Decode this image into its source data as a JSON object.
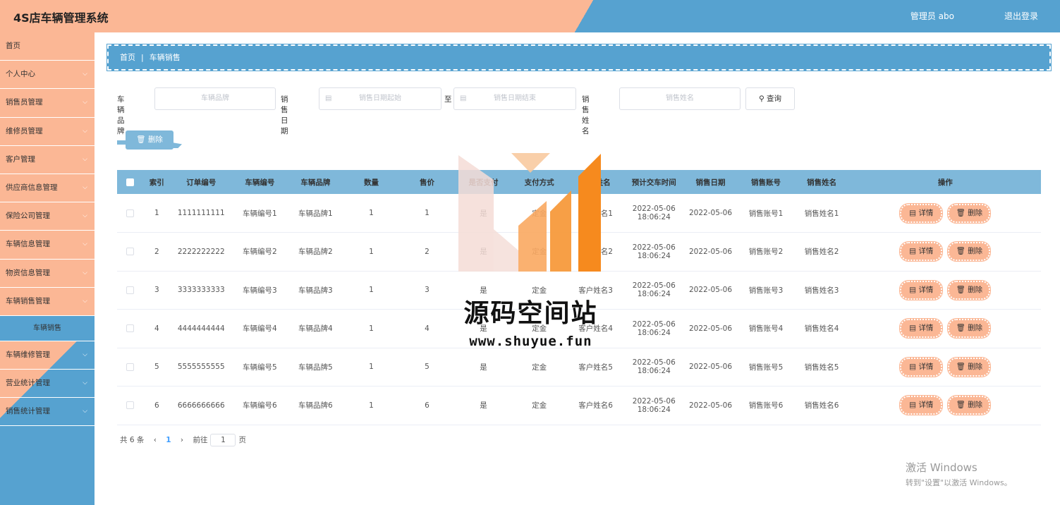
{
  "app": {
    "title": "4S店车辆管理系统",
    "user": "管理员 abo",
    "logout": "退出登录"
  },
  "sidebar": {
    "items": [
      {
        "label": "首页",
        "chevron": false
      },
      {
        "label": "个人中心",
        "chevron": true
      },
      {
        "label": "销售员管理",
        "chevron": true
      },
      {
        "label": "维修员管理",
        "chevron": true
      },
      {
        "label": "客户管理",
        "chevron": true
      },
      {
        "label": "供应商信息管理",
        "chevron": true
      },
      {
        "label": "保险公司管理",
        "chevron": true
      },
      {
        "label": "车辆信息管理",
        "chevron": true
      },
      {
        "label": "物资信息管理",
        "chevron": true
      },
      {
        "label": "车辆销售管理",
        "chevron": true
      }
    ],
    "sub_item": "车辆销售",
    "items2": [
      {
        "label": "车辆维修管理",
        "chevron": true
      },
      {
        "label": "营业统计管理",
        "chevron": true
      },
      {
        "label": "销售统计管理",
        "chevron": true
      }
    ]
  },
  "breadcrumb": {
    "home": "首页",
    "sep": "|",
    "current": "车辆销售"
  },
  "filters": {
    "brand_label": "车辆品牌",
    "brand_placeholder": "车辆品牌",
    "date_label": "销售日期",
    "date_start_placeholder": "销售日期起始",
    "to": "至",
    "date_end_placeholder": "销售日期结束",
    "name_label": "销售姓名",
    "name_placeholder": "销售姓名",
    "search": "查询"
  },
  "toolbar": {
    "delete": "删除"
  },
  "table": {
    "headers": [
      "索引",
      "订单编号",
      "车辆编号",
      "车辆品牌",
      "数量",
      "售价",
      "是否支付",
      "支付方式",
      "客户姓名",
      "预计交车时间",
      "销售日期",
      "销售账号",
      "销售姓名",
      "操作"
    ],
    "rows": [
      {
        "idx": "1",
        "order": "1111111111",
        "car_no": "车辆编号1",
        "brand": "车辆品牌1",
        "qty": "1",
        "price": "1",
        "paid": "是",
        "pay": "定金",
        "customer": "客户姓名1",
        "deliver_d": "2022-05-06",
        "deliver_t": "18:06:24",
        "date": "2022-05-06",
        "account": "销售账号1",
        "seller": "销售姓名1"
      },
      {
        "idx": "2",
        "order": "2222222222",
        "car_no": "车辆编号2",
        "brand": "车辆品牌2",
        "qty": "1",
        "price": "2",
        "paid": "是",
        "pay": "定金",
        "customer": "客户姓名2",
        "deliver_d": "2022-05-06",
        "deliver_t": "18:06:24",
        "date": "2022-05-06",
        "account": "销售账号2",
        "seller": "销售姓名2"
      },
      {
        "idx": "3",
        "order": "3333333333",
        "car_no": "车辆编号3",
        "brand": "车辆品牌3",
        "qty": "1",
        "price": "3",
        "paid": "是",
        "pay": "定金",
        "customer": "客户姓名3",
        "deliver_d": "2022-05-06",
        "deliver_t": "18:06:24",
        "date": "2022-05-06",
        "account": "销售账号3",
        "seller": "销售姓名3"
      },
      {
        "idx": "4",
        "order": "4444444444",
        "car_no": "车辆编号4",
        "brand": "车辆品牌4",
        "qty": "1",
        "price": "4",
        "paid": "是",
        "pay": "定金",
        "customer": "客户姓名4",
        "deliver_d": "2022-05-06",
        "deliver_t": "18:06:24",
        "date": "2022-05-06",
        "account": "销售账号4",
        "seller": "销售姓名4"
      },
      {
        "idx": "5",
        "order": "5555555555",
        "car_no": "车辆编号5",
        "brand": "车辆品牌5",
        "qty": "1",
        "price": "5",
        "paid": "是",
        "pay": "定金",
        "customer": "客户姓名5",
        "deliver_d": "2022-05-06",
        "deliver_t": "18:06:24",
        "date": "2022-05-06",
        "account": "销售账号5",
        "seller": "销售姓名5"
      },
      {
        "idx": "6",
        "order": "6666666666",
        "car_no": "车辆编号6",
        "brand": "车辆品牌6",
        "qty": "1",
        "price": "6",
        "paid": "是",
        "pay": "定金",
        "customer": "客户姓名6",
        "deliver_d": "2022-05-06",
        "deliver_t": "18:06:24",
        "date": "2022-05-06",
        "account": "销售账号6",
        "seller": "销售姓名6"
      }
    ],
    "detail": "详情",
    "delete": "删除"
  },
  "pager": {
    "total": "共 6 条",
    "prev": "‹",
    "page": "1",
    "next": "›",
    "goto": "前往",
    "page_input": "1",
    "page_suffix": "页"
  },
  "watermark": {
    "text": "源码空间站",
    "url": "www.shuyue.fun"
  },
  "os": {
    "activate_title": "激活 Windows",
    "activate_sub": "转到\"设置\"以激活 Windows。"
  },
  "colors": {
    "peach": "#fbb795",
    "blue": "#56a2d0",
    "table_head": "#7fb8da"
  }
}
